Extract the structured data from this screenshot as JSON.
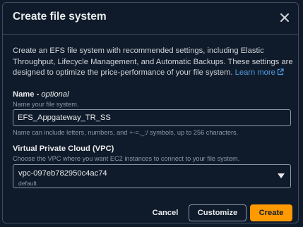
{
  "dialog": {
    "title": "Create file system",
    "description": "Create an EFS file system with recommended settings, including Elastic Throughput, Lifecycle Management, and Automatic Backups. These settings are designed to optimize the price-performance of your file system.",
    "learn_more": "Learn more"
  },
  "name_field": {
    "label": "Name - ",
    "label_optional": "optional",
    "hint": "Name your file system.",
    "value": "EFS_Appgateway_TR_SS",
    "constraint": "Name can include letters, numbers, and +-=._:/ symbols, up to 256 characters."
  },
  "vpc_field": {
    "label": "Virtual Private Cloud (VPC)",
    "hint": "Choose the VPC where you want EC2 instances to connect to your file system.",
    "value": "vpc-097eb782950c4ac74",
    "sub": "default"
  },
  "buttons": {
    "cancel": "Cancel",
    "customize": "Customize",
    "create": "Create"
  },
  "colors": {
    "background": "#0f1b2a",
    "link": "#539fe5",
    "primary": "#ff9900"
  }
}
